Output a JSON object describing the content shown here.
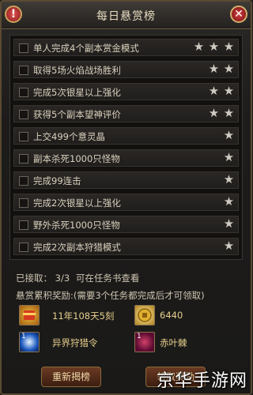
{
  "title": "每日悬赏榜",
  "tasks": [
    {
      "label": "单人完成4个副本赏金模式",
      "stars": 3
    },
    {
      "label": "取得5场火焰战场胜利",
      "stars": 2
    },
    {
      "label": "完成5次银星以上强化",
      "stars": 2
    },
    {
      "label": "获得5个副本望神评价",
      "stars": 2
    },
    {
      "label": "上交499个意灵晶",
      "stars": 1
    },
    {
      "label": "副本杀死1000只怪物",
      "stars": 1
    },
    {
      "label": "完成99连击",
      "stars": 1
    },
    {
      "label": "完成2次银星以上强化",
      "stars": 1
    },
    {
      "label": "野外杀死1000只怪物",
      "stars": 1
    },
    {
      "label": "完成2次副本狩猎模式",
      "stars": 1
    }
  ],
  "status": {
    "accepted_label": "已接取：",
    "accepted_value": "3/3",
    "hint": "可在任务书查看"
  },
  "rewards_label": "悬赏累积奖励:(需要3个任务都完成后才可领取)",
  "rewards": [
    {
      "name": "11年108天5刻",
      "count": "",
      "icon": "scroll-icon"
    },
    {
      "name": "6440",
      "count": "",
      "icon": "gold-coin-icon"
    },
    {
      "name": "异界狩猎令",
      "count": "1",
      "icon": "hunt-token-icon"
    },
    {
      "name": "赤叶棘",
      "count": "1",
      "icon": "red-leaf-icon"
    }
  ],
  "buttons": {
    "refresh": "重新揭榜",
    "claim": "领取奖励"
  },
  "watermark": "京华手游网",
  "colors": {
    "accent": "#e6cf8c",
    "button": "#6b3a22",
    "star": "#cfcac1"
  }
}
